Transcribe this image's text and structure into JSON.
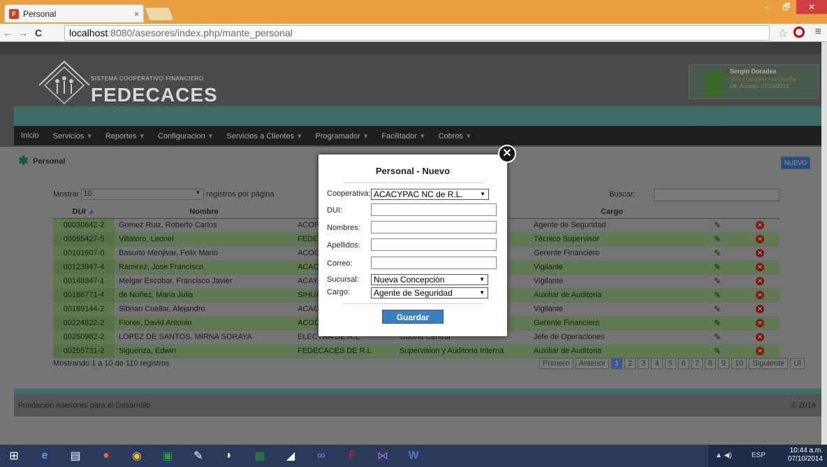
{
  "browser": {
    "tab_title": "Personal",
    "tab_close": "×",
    "url_host": "localhost",
    "url_path": ":8080/asesores/index.php/mante_personal",
    "win_min": "–",
    "win_max": "🗗",
    "win_close": "✕"
  },
  "header": {
    "logo_sub": "SISTEMA COOPERATIVO FINANCIERO",
    "logo_name": "FEDECACES",
    "user_name": "Sergio Doradea",
    "user_links": "Salir | Cambiar contraseña",
    "last_access": "Ult. Acceso: 07/10/2014"
  },
  "nav": [
    "Inicio",
    "Servicios",
    "Reportes",
    "Configuracion",
    "Servicios a Clientes",
    "Programador",
    "Facilitador",
    "Cobros"
  ],
  "page": {
    "title": "Personal",
    "new_button": "NUEVO",
    "mostrar": "Mostrar",
    "mostrar_value": "10",
    "registros": "registros por página",
    "buscar": "Buscar:",
    "columns": {
      "dui": "DUI",
      "nombre": "Nombre",
      "cargo": "Cargo"
    },
    "rows": [
      {
        "dui": "00030642-2",
        "nombre": "Gomez Ruiz, Roberto Carlos",
        "coop": "ACOP",
        "suc": "",
        "cargo": "Agente de Seguridad"
      },
      {
        "dui": "00095427-5",
        "nombre": "Villatoro, Leonel",
        "coop": "FEDE",
        "suc": "",
        "cargo": "Técnico Supervisor"
      },
      {
        "dui": "00101607-0",
        "nombre": "Basurto Menjivar, Felix Mario",
        "coop": "ACOC",
        "suc": "",
        "cargo": "Gerente Financiero"
      },
      {
        "dui": "00123947-4",
        "nombre": "Ramirez, Jose Francisco",
        "coop": "ACAC",
        "suc": "",
        "cargo": "Vigilante"
      },
      {
        "dui": "00148347-1",
        "nombre": "Melgar Escobar, Francisco Javier",
        "coop": "ACAY",
        "suc": "",
        "cargo": "Vigilante"
      },
      {
        "dui": "00186771-4",
        "nombre": "de Nuñez, Maria Julia",
        "coop": "SIHUA",
        "suc": "",
        "cargo": "Auxiliar de Auditoria"
      },
      {
        "dui": "00189144-2",
        "nombre": "Sibrian Cuellar, Alejandro",
        "coop": "ACAC",
        "suc": "",
        "cargo": "Vigilante"
      },
      {
        "dui": "00224822-2",
        "nombre": "Flores, David Antonio",
        "coop": "ACOD",
        "suc": "",
        "cargo": "Gerente Financiero"
      },
      {
        "dui": "00250982-2",
        "nombre": "LOPEZ DE SANTOS, MIRNA SORAYA",
        "coop": "ELECTRA DE R.L.",
        "suc": "Oficina Central",
        "cargo": "Jefe de Operaciones"
      },
      {
        "dui": "00255731-2",
        "nombre": "Siguenza, Edwin",
        "coop": "FEDECACES DE R.L.",
        "suc": "Supervision y Auditoria Interna",
        "cargo": "Auxiliar de Auditoria"
      }
    ],
    "mostrando": "Mostrando 1 a 10 de 110 registros",
    "pager": [
      "Primero",
      "Anterior",
      "1",
      "2",
      "3",
      "4",
      "5",
      "6",
      "7",
      "8",
      "9",
      "10",
      "Siguiente",
      "Ul"
    ]
  },
  "footer": {
    "left": "Fundación Asesores para el Desarrollo",
    "right": "© 2014"
  },
  "modal": {
    "title": "Personal - Nuevo",
    "cooperativa_label": "Cooperativa:",
    "cooperativa_value": "ACACYPAC NC de R.L.",
    "dui_label": "DUI:",
    "nombres_label": "Nombres:",
    "apellidos_label": "Apellidos:",
    "correo_label": "Correo:",
    "sucursal_label": "Sucursal:",
    "sucursal_value": "Nueva Concepción",
    "cargo_label": "Cargo:",
    "cargo_value": "Agente de Seguridad",
    "guardar": "Guardar",
    "close": "✕"
  },
  "taskbar": {
    "lang": "ESP",
    "time": "10:44 a.m.",
    "date": "07/10/2014"
  }
}
